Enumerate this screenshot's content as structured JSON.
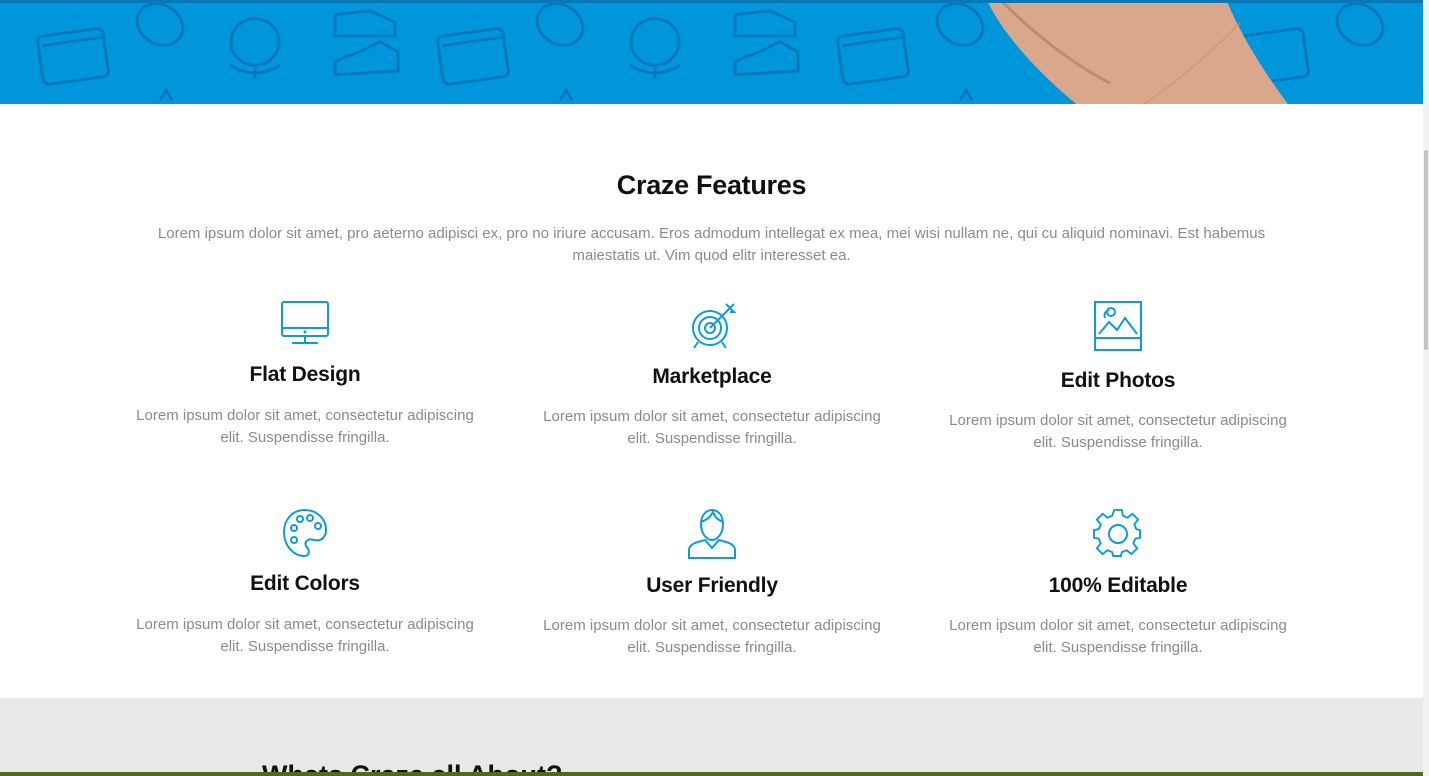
{
  "hero": {
    "background_color": "#0096dc",
    "pattern_icons": [
      "browser-window-icon",
      "globe-icon",
      "sneaker-icon",
      "mouse-icon"
    ]
  },
  "features": {
    "title": "Craze Features",
    "intro": "Lorem ipsum dolor sit amet, pro aeterno adipisci ex, pro no iriure accusam. Eros admodum intellegat ex mea, mei wisi nullam ne, qui cu aliquid nominavi. Est habemus maiestatis ut. Vim quod elitr interesset ea.",
    "accent_color": "#0f9bd7",
    "items": [
      {
        "icon": "monitor-icon",
        "title": "Flat Design",
        "text": "Lorem ipsum dolor sit amet, consectetur adipiscing elit. Suspendisse fringilla."
      },
      {
        "icon": "target-icon",
        "title": "Marketplace",
        "text": "Lorem ipsum dolor sit amet, consectetur adipiscing elit. Suspendisse fringilla."
      },
      {
        "icon": "photo-icon",
        "title": "Edit Photos",
        "text": "Lorem ipsum dolor sit amet, consectetur adipiscing elit. Suspendisse fringilla."
      },
      {
        "icon": "palette-icon",
        "title": "Edit Colors",
        "text": "Lorem ipsum dolor sit amet, consectetur adipiscing elit. Suspendisse fringilla."
      },
      {
        "icon": "user-icon",
        "title": "User Friendly",
        "text": "Lorem ipsum dolor sit amet, consectetur adipiscing elit. Suspendisse fringilla."
      },
      {
        "icon": "gear-icon",
        "title": "100% Editable",
        "text": "Lorem ipsum dolor sit amet, consectetur adipiscing elit. Suspendisse fringilla."
      }
    ]
  },
  "about": {
    "title": "Whats Craze all About?"
  }
}
